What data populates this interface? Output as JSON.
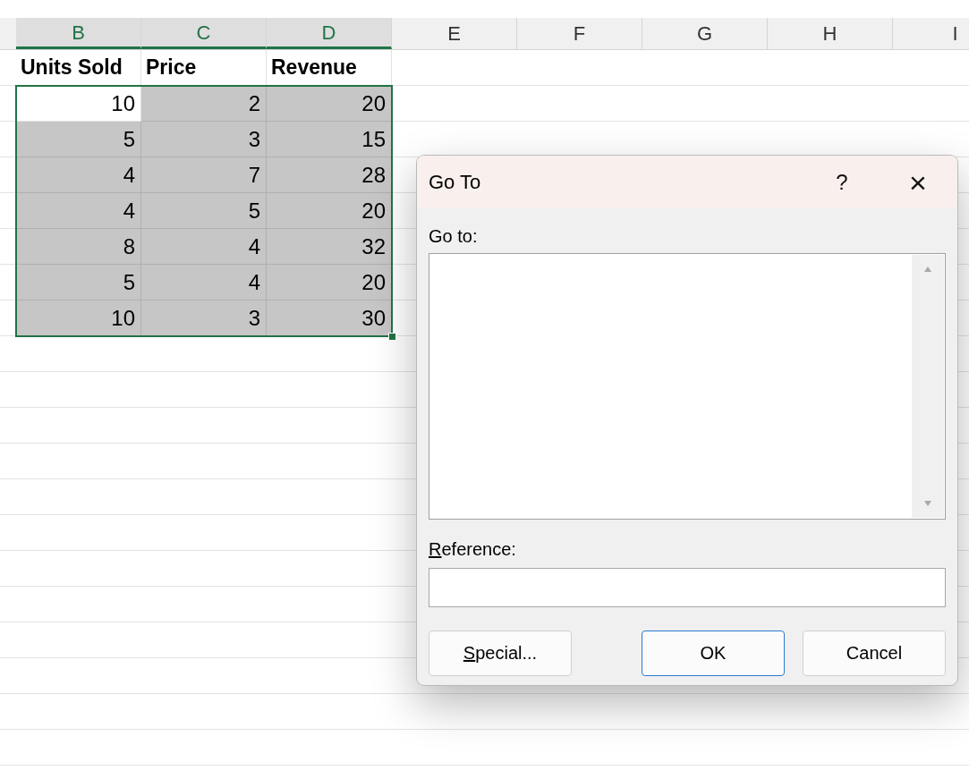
{
  "sheet": {
    "columns": [
      {
        "label": "B",
        "selected": true
      },
      {
        "label": "C",
        "selected": true
      },
      {
        "label": "D",
        "selected": true
      },
      {
        "label": "E",
        "selected": false
      },
      {
        "label": "F",
        "selected": false
      },
      {
        "label": "G",
        "selected": false
      },
      {
        "label": "H",
        "selected": false
      },
      {
        "label": "I",
        "selected": false
      }
    ],
    "rows": [
      {
        "cells": [
          {
            "kind": "header",
            "text": "Units Sold",
            "selected": false
          },
          {
            "kind": "header",
            "text": "Price",
            "selected": false
          },
          {
            "kind": "header",
            "text": "Revenue",
            "selected": false
          }
        ]
      },
      {
        "cells": [
          {
            "kind": "number",
            "text": "10",
            "selected": true,
            "active": true
          },
          {
            "kind": "number",
            "text": "2",
            "selected": true,
            "active": false
          },
          {
            "kind": "number",
            "text": "20",
            "selected": true,
            "active": false
          }
        ]
      },
      {
        "cells": [
          {
            "kind": "number",
            "text": "5",
            "selected": true,
            "active": false
          },
          {
            "kind": "number",
            "text": "3",
            "selected": true,
            "active": false
          },
          {
            "kind": "number",
            "text": "15",
            "selected": true,
            "active": false
          }
        ]
      },
      {
        "cells": [
          {
            "kind": "number",
            "text": "4",
            "selected": true,
            "active": false
          },
          {
            "kind": "number",
            "text": "7",
            "selected": true,
            "active": false
          },
          {
            "kind": "number",
            "text": "28",
            "selected": true,
            "active": false
          }
        ]
      },
      {
        "cells": [
          {
            "kind": "number",
            "text": "4",
            "selected": true,
            "active": false
          },
          {
            "kind": "number",
            "text": "5",
            "selected": true,
            "active": false
          },
          {
            "kind": "number",
            "text": "20",
            "selected": true,
            "active": false
          }
        ]
      },
      {
        "cells": [
          {
            "kind": "number",
            "text": "8",
            "selected": true,
            "active": false
          },
          {
            "kind": "number",
            "text": "4",
            "selected": true,
            "active": false
          },
          {
            "kind": "number",
            "text": "32",
            "selected": true,
            "active": false
          }
        ]
      },
      {
        "cells": [
          {
            "kind": "number",
            "text": "5",
            "selected": true,
            "active": false
          },
          {
            "kind": "number",
            "text": "4",
            "selected": true,
            "active": false
          },
          {
            "kind": "number",
            "text": "20",
            "selected": true,
            "active": false
          }
        ]
      },
      {
        "cells": [
          {
            "kind": "number",
            "text": "10",
            "selected": true,
            "active": false
          },
          {
            "kind": "number",
            "text": "3",
            "selected": true,
            "active": false
          },
          {
            "kind": "number",
            "text": "30",
            "selected": true,
            "active": false
          }
        ]
      }
    ]
  },
  "dialog": {
    "title": "Go To",
    "help": "?",
    "close": "×",
    "list_label": "Go to:",
    "reference": {
      "label": "Reference:",
      "underline_first": true
    },
    "buttons": [
      {
        "label": "Special...",
        "underline_first": true,
        "default": false
      },
      {
        "label": "OK",
        "underline_first": false,
        "default": true
      },
      {
        "label": "Cancel",
        "underline_first": false,
        "default": false
      }
    ]
  }
}
